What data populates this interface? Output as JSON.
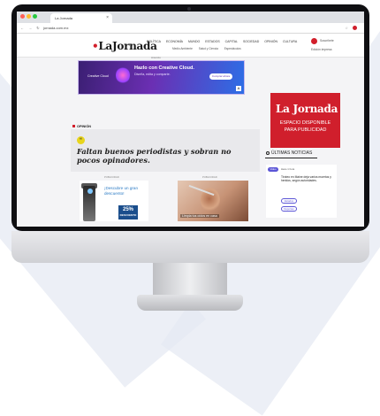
{
  "browser": {
    "tab_title": "La Jornada",
    "tab_close": "×",
    "nav_icons": "← → ↻",
    "url": "jornada.com.mx",
    "extensions": "☆"
  },
  "site": {
    "logo_text": "La",
    "logo_text2": "Jornada",
    "menu": [
      "POLÍTICA",
      "ECONOMÍA",
      "MUNDO",
      "ESTADOS",
      "CAPITAL",
      "SOCIEDAD",
      "OPINIÓN",
      "CULTURA"
    ],
    "submenu": [
      "Medio Ambiente",
      "Salud y Ciencia",
      "Espectáculos"
    ],
    "header_right_label": "Suscríbete",
    "header_right_secondary": "Edición impresa"
  },
  "ad": {
    "label": "Anuncio",
    "brand": "Creative Cloud",
    "title": "Hazlo con Creative Cloud.",
    "subtitle": "Diseña, edita y comparte.",
    "cta": "Comprar ahora",
    "vendor_mark": "A"
  },
  "opinion": {
    "section_label": "OPINIÓN",
    "quote_mark": "“",
    "text": "Faltan buenos periodistas y sobran no pocos opinadores."
  },
  "cards": {
    "left_label": "PUBLICIDAD",
    "left_promo": "¡Descubre un gran descuento!",
    "left_pct": "25%",
    "left_pct_sub": "DESCUENTO",
    "right_label": "PUBLICIDAD",
    "right_caption": "Limpia tus oídos en casa"
  },
  "sidebar": {
    "promo_logo": "La Jornada",
    "promo_line1": "ESPACIO DISPONIBLE",
    "promo_line2": "PARA PUBLICIDAD",
    "latest_title": "ÚLTIMAS NOTICIAS",
    "latest_tag": "Video",
    "latest_time": "Hace 1 hora",
    "latest_headline": "Tiroteo en Maine deja varios muertos y heridos, según autoridades.",
    "pill1": "Estados",
    "pill2": "Deportes"
  },
  "colors": {
    "brand_red": "#d01f2c",
    "accent_purple": "#5b55d6",
    "quote_yellow": "#e8d51d"
  }
}
